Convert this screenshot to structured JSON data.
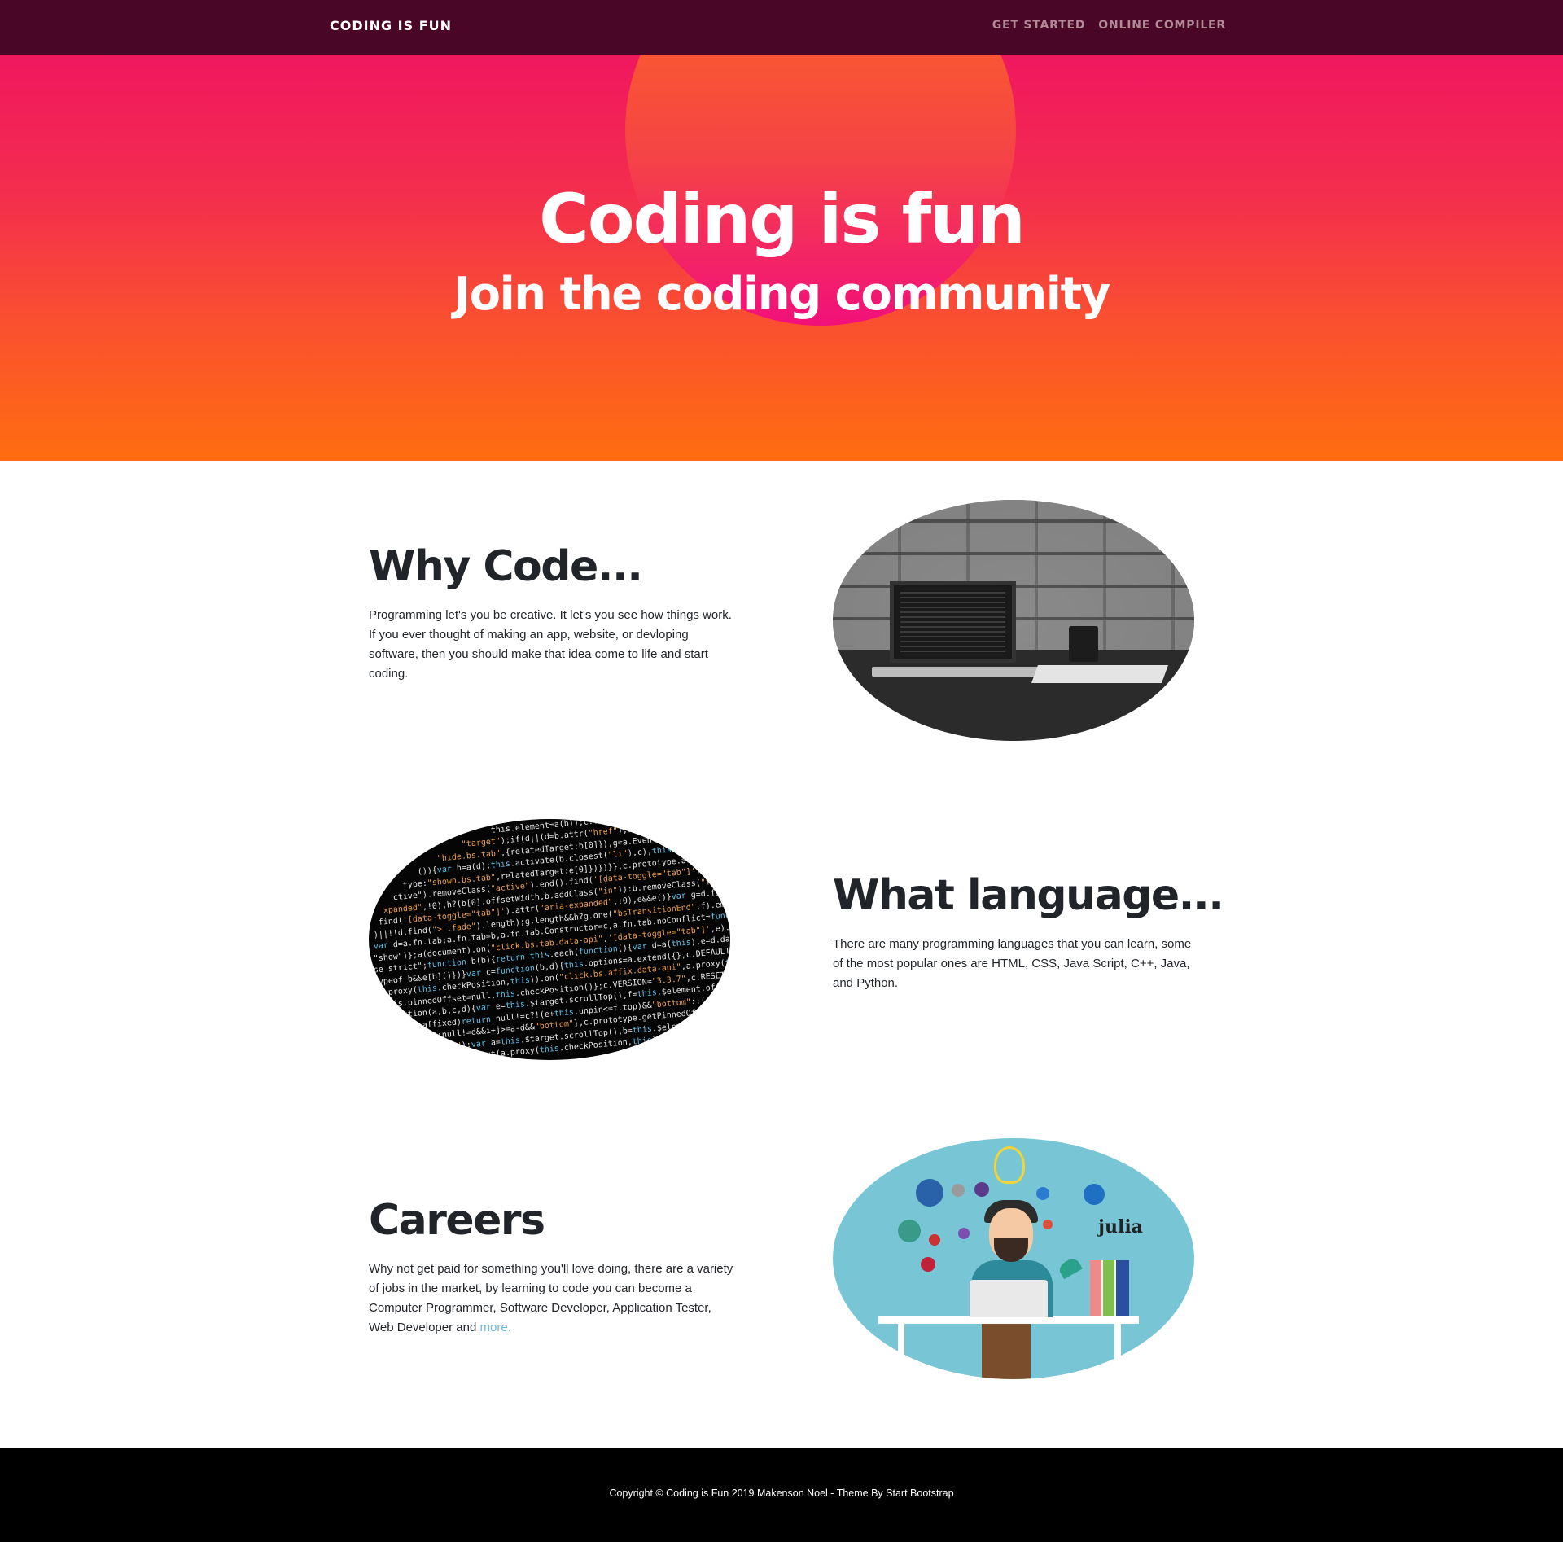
{
  "navbar": {
    "brand": "CODING IS FUN",
    "links": [
      {
        "label": "GET STARTED"
      },
      {
        "label": "ONLINE COMPILER"
      }
    ]
  },
  "hero": {
    "title": "Coding is fun",
    "subtitle": "Join the coding community"
  },
  "sections": [
    {
      "heading": "Why Code...",
      "text": "Programming let's you be creative. It let's you see how things work. If you ever thought of making an app, website, or devloping software, then you should make that idea come to life and start coding.",
      "image": "laptop-on-desk-photo"
    },
    {
      "heading": "What language...",
      "text": "There are many programming languages that you can learn, some of the most popular ones are HTML, CSS, Java Script, C++, Java, and Python.",
      "image": "code-screen-photo"
    },
    {
      "heading": "Careers",
      "text": "Why not get paid for something you'll love doing, there are a variety of jobs in the market, by learning to code you can become a Computer Programmer, Software Developer, Application Tester, Web Developer and ",
      "link_text": "more.",
      "image": "developer-illustration"
    }
  ],
  "footer": {
    "text": "Copyright © Coding is Fun 2019 Makenson Noel - Theme By Start Bootstrap"
  },
  "colors": {
    "navbar_bg": "#4a0626",
    "hero_top": "#f0175f",
    "hero_bottom": "#ff6d0f",
    "link": "#6fb7e3",
    "footer_bg": "#000000"
  }
}
